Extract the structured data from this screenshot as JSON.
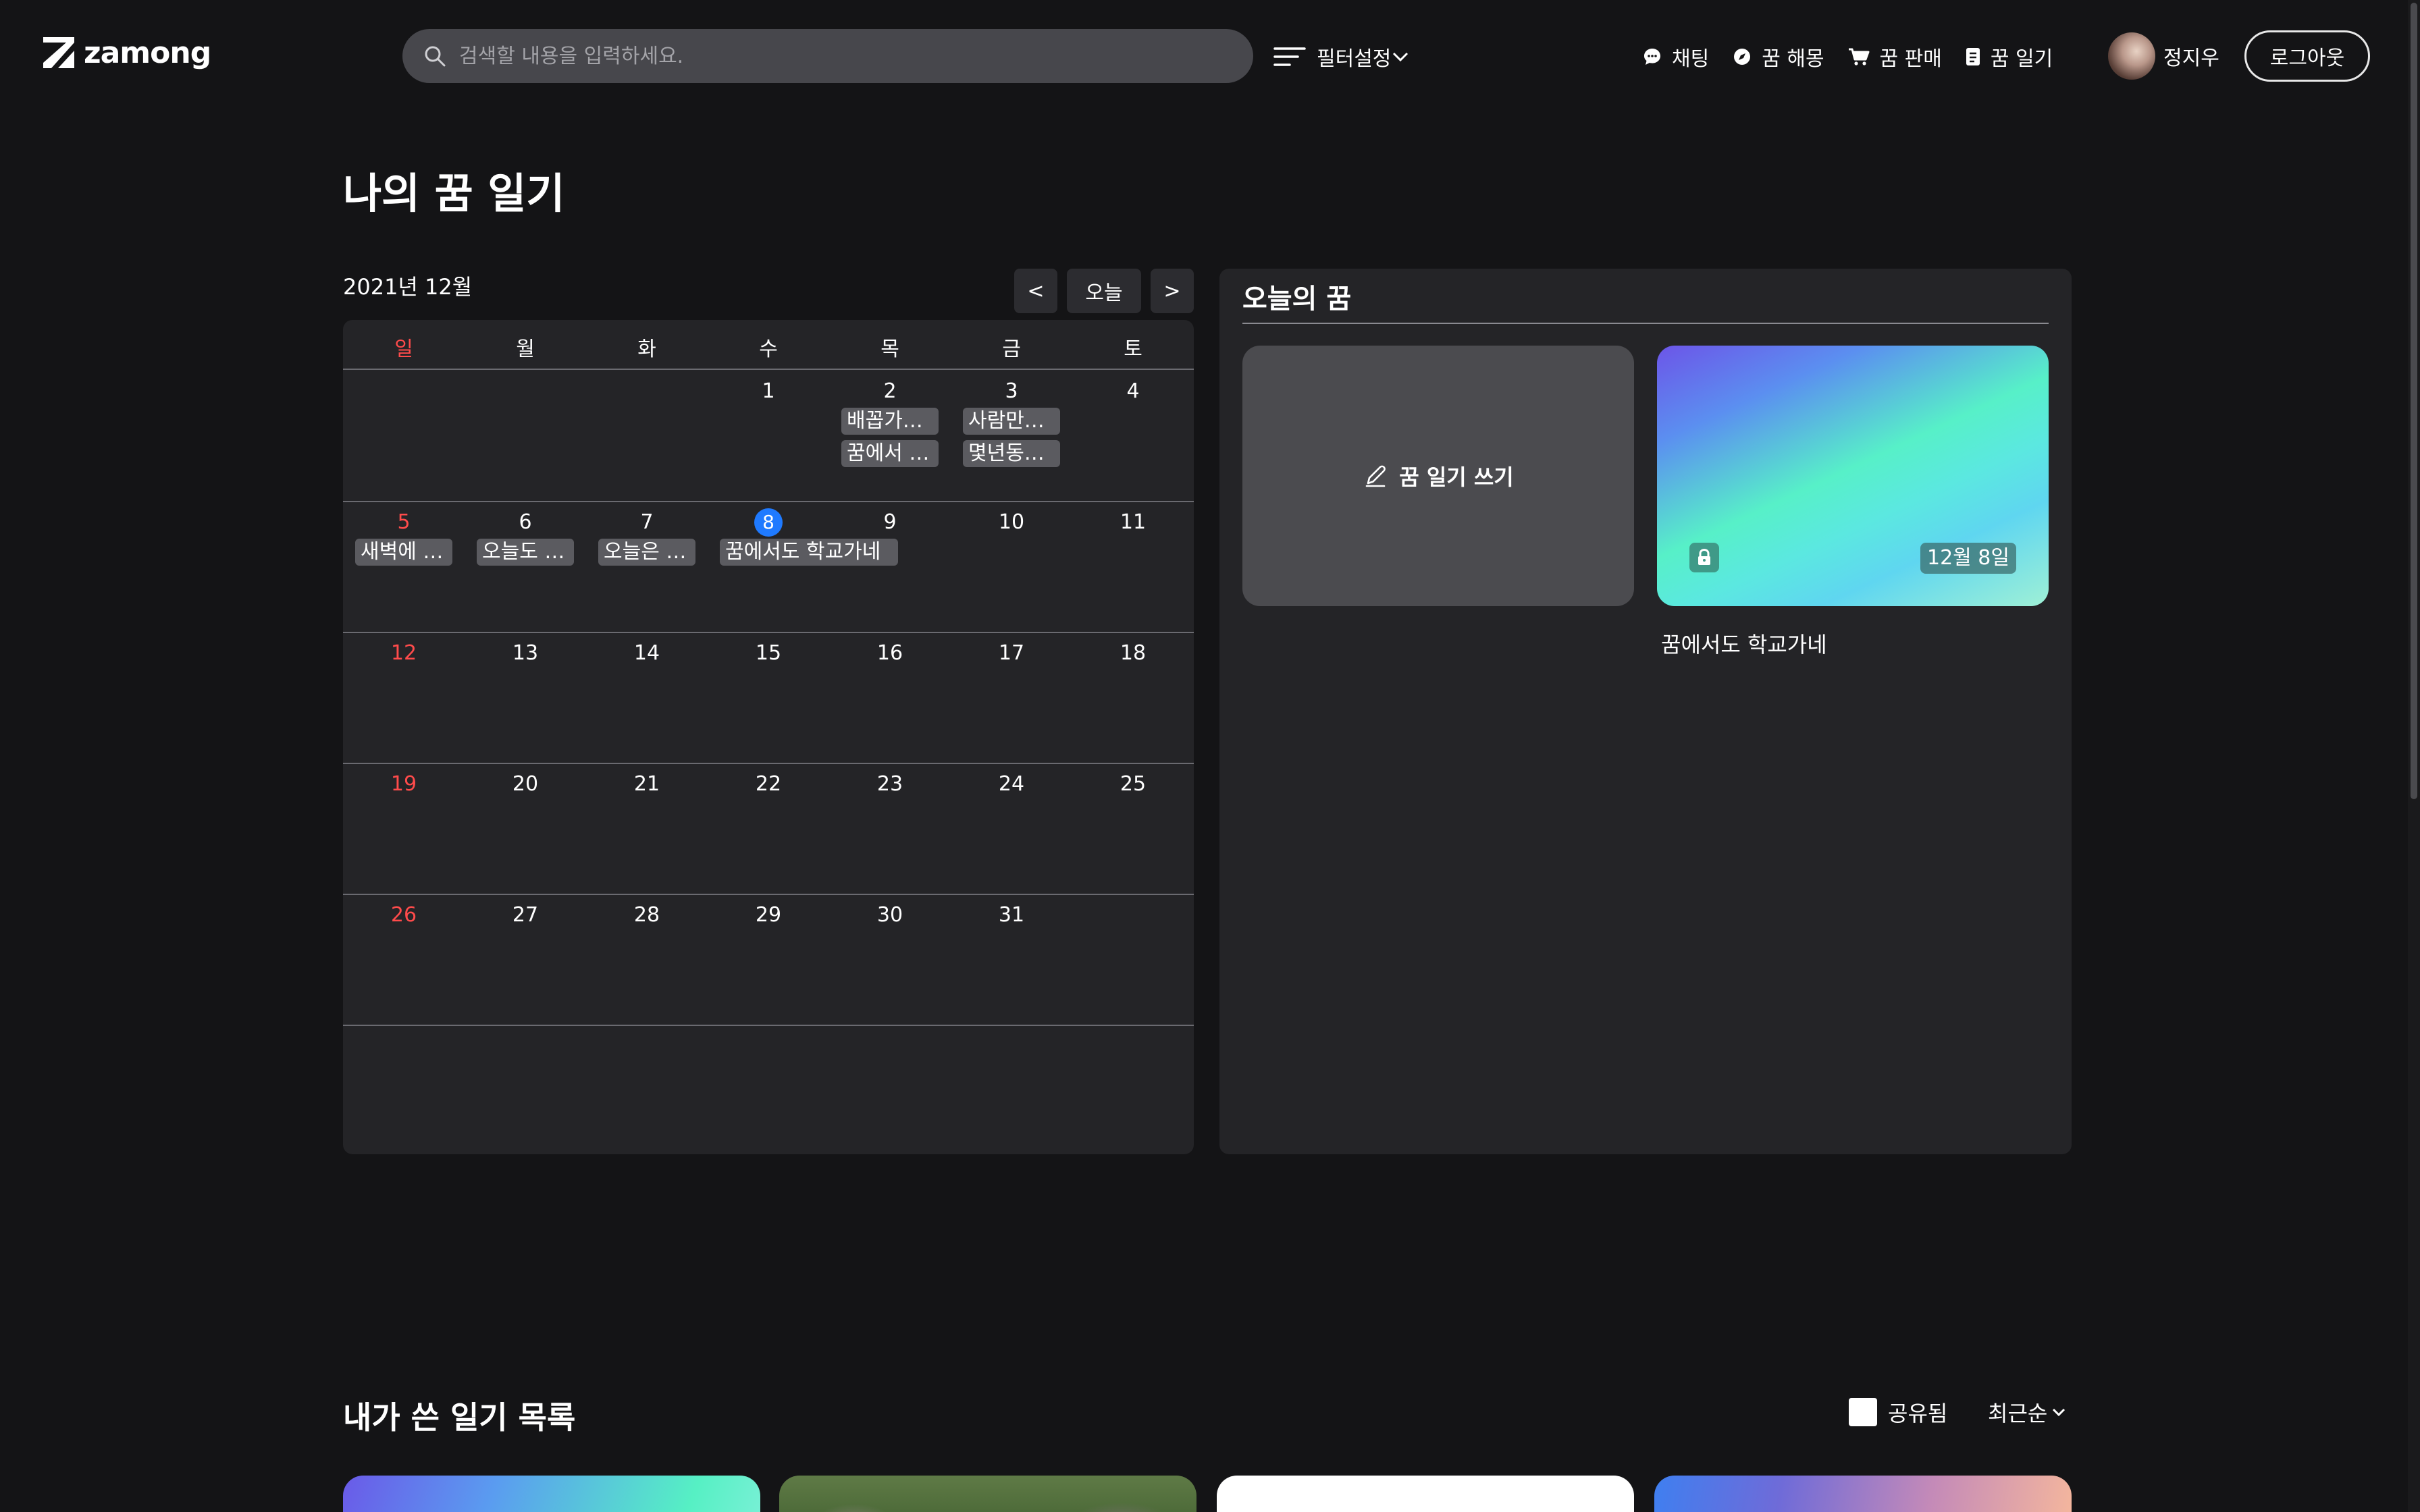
{
  "header": {
    "logo_text": "zamong",
    "search_placeholder": "검색할 내용을 입력하세요.",
    "filter_label": "필터설정",
    "nav": [
      {
        "label": "채팅",
        "icon": "chat-icon"
      },
      {
        "label": "꿈 해몽",
        "icon": "compass-icon"
      },
      {
        "label": "꿈 판매",
        "icon": "cart-icon"
      },
      {
        "label": "꿈 일기",
        "icon": "diary-icon"
      }
    ],
    "user_name": "정지우",
    "logout_label": "로그아웃"
  },
  "page_title": "나의 꿈 일기",
  "calendar": {
    "month_label": "2021년 12월",
    "prev_label": "<",
    "today_label": "오늘",
    "next_label": ">",
    "weekdays": [
      "일",
      "월",
      "화",
      "수",
      "목",
      "금",
      "토"
    ],
    "weeks": [
      [
        "",
        "",
        "",
        "1",
        "2",
        "3",
        "4"
      ],
      [
        "5",
        "6",
        "7",
        "8",
        "9",
        "10",
        "11"
      ],
      [
        "12",
        "13",
        "14",
        "15",
        "16",
        "17",
        "18"
      ],
      [
        "19",
        "20",
        "21",
        "22",
        "23",
        "24",
        "25"
      ],
      [
        "26",
        "27",
        "28",
        "29",
        "30",
        "31",
        ""
      ]
    ],
    "today_day": "8",
    "events": {
      "dec2_a": "배꼽가…",
      "dec2_b": "꿈에서 …",
      "dec3_a": "사람만…",
      "dec3_b": "몇년동…",
      "dec5": "새벽에 …",
      "dec6": "오늘도 …",
      "dec7": "오늘은 …",
      "dec8": "꿈에서도 학교가네"
    }
  },
  "today_panel": {
    "title": "오늘의 꿈",
    "write_label": "꿈 일기 쓰기",
    "card_date": "12월 8일",
    "card_title": "꿈에서도 학교가네"
  },
  "list_section": {
    "title": "내가 쓴 일기 목록",
    "shared_label": "공유됨",
    "sort_label": "최근순"
  },
  "colors": {
    "background": "#141416",
    "panel": "#242427",
    "sunday": "#ff4b4b",
    "today_accent": "#1f7aff"
  }
}
